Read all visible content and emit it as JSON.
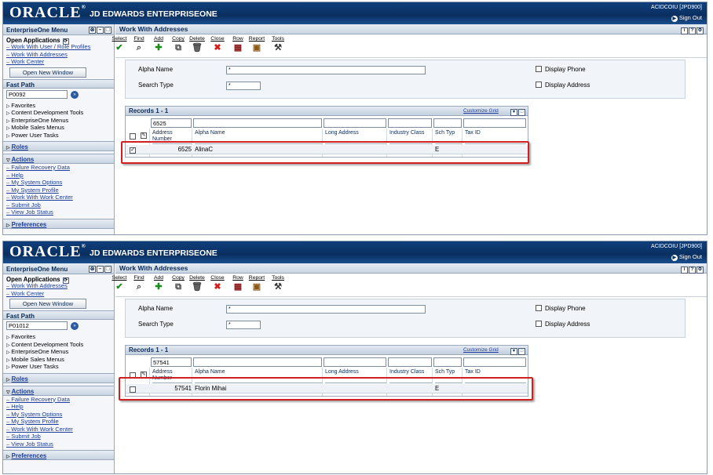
{
  "screens": [
    {
      "banner": {
        "logo": "ORACLE",
        "product": "JD EDWARDS ENTERPRISEONE",
        "user": "ACIDCOIU [JPD900]",
        "signout": "Sign Out"
      },
      "menu": {
        "title": "EnterpriseOne Menu",
        "open_apps_label": "Open Applications",
        "open_apps": [
          "Work With User / Role Profiles",
          "Work With Addresses",
          "Work Center"
        ],
        "open_new_window": "Open New Window",
        "fast_path_label": "Fast Path",
        "fast_path_value": "P0092",
        "tree": [
          "Favorites",
          "Content Development Tools",
          "EnterpriseOne Menus",
          "Mobile Sales Menus",
          "Power User Tasks"
        ],
        "roles": "Roles",
        "actions": "Actions",
        "action_links": [
          "Failure Recovery Data",
          "Help",
          "My System Options",
          "My System Profile",
          "Work With Work Center",
          "Submit Job",
          "View Job Status"
        ],
        "preferences": "Preferences"
      },
      "form": {
        "title": "Work With Addresses",
        "toolbar": [
          "Select",
          "Find",
          "Add",
          "Copy",
          "Delete",
          "Close",
          "Row",
          "Report",
          "Tools"
        ],
        "alpha_name_label": "Alpha Name",
        "alpha_name_value": "*",
        "search_type_label": "Search Type",
        "search_type_value": "*",
        "display_phone": "Display Phone",
        "display_address": "Display Address"
      },
      "grid": {
        "records": "Records 1 - 1",
        "customize": "Customize Grid",
        "qbe_address": "6525",
        "columns": [
          "Address Number",
          "Alpha Name",
          "Long Address",
          "Industry Class",
          "Sch Typ",
          "Tax ID"
        ],
        "row": {
          "address_number": "6525",
          "alpha_name": "AlinaC",
          "sch_typ": "E",
          "checked": true
        }
      }
    },
    {
      "banner": {
        "logo": "ORACLE",
        "product": "JD EDWARDS ENTERPRISEONE",
        "user": "ACIDCOIU [JPD900]",
        "signout": "Sign Out"
      },
      "menu": {
        "title": "EnterpriseOne Menu",
        "open_apps_label": "Open Applications",
        "open_apps": [
          "Work With Addresses",
          "Work Center"
        ],
        "open_new_window": "Open New Window",
        "fast_path_label": "Fast Path",
        "fast_path_value": "P01012",
        "tree": [
          "Favorites",
          "Content Development Tools",
          "EnterpriseOne Menus",
          "Mobile Sales Menus",
          "Power User Tasks"
        ],
        "roles": "Roles",
        "actions": "Actions",
        "action_links": [
          "Failure Recovery Data",
          "Help",
          "My System Options",
          "My System Profile",
          "Work With Work Center",
          "Submit Job",
          "View Job Status"
        ],
        "preferences": "Preferences"
      },
      "form": {
        "title": "Work With Addresses",
        "toolbar": [
          "Select",
          "Find",
          "Add",
          "Copy",
          "Delete",
          "Close",
          "Row",
          "Report",
          "Tools"
        ],
        "alpha_name_label": "Alpha Name",
        "alpha_name_value": "*",
        "search_type_label": "Search Type",
        "search_type_value": "*",
        "display_phone": "Display Phone",
        "display_address": "Display Address"
      },
      "grid": {
        "records": "Records 1 - 1",
        "customize": "Customize Grid",
        "qbe_address": "57541",
        "columns": [
          "Address Number",
          "Alpha Name",
          "Long Address",
          "Industry Class",
          "Sch Typ",
          "Tax ID"
        ],
        "row": {
          "address_number": "57541",
          "alpha_name": "Florin Mihai",
          "sch_typ": "E",
          "checked": false
        }
      }
    }
  ],
  "colors": {
    "banner": "#0a2f60",
    "link": "#1f3f9a",
    "highlight": "#d21f1f"
  }
}
